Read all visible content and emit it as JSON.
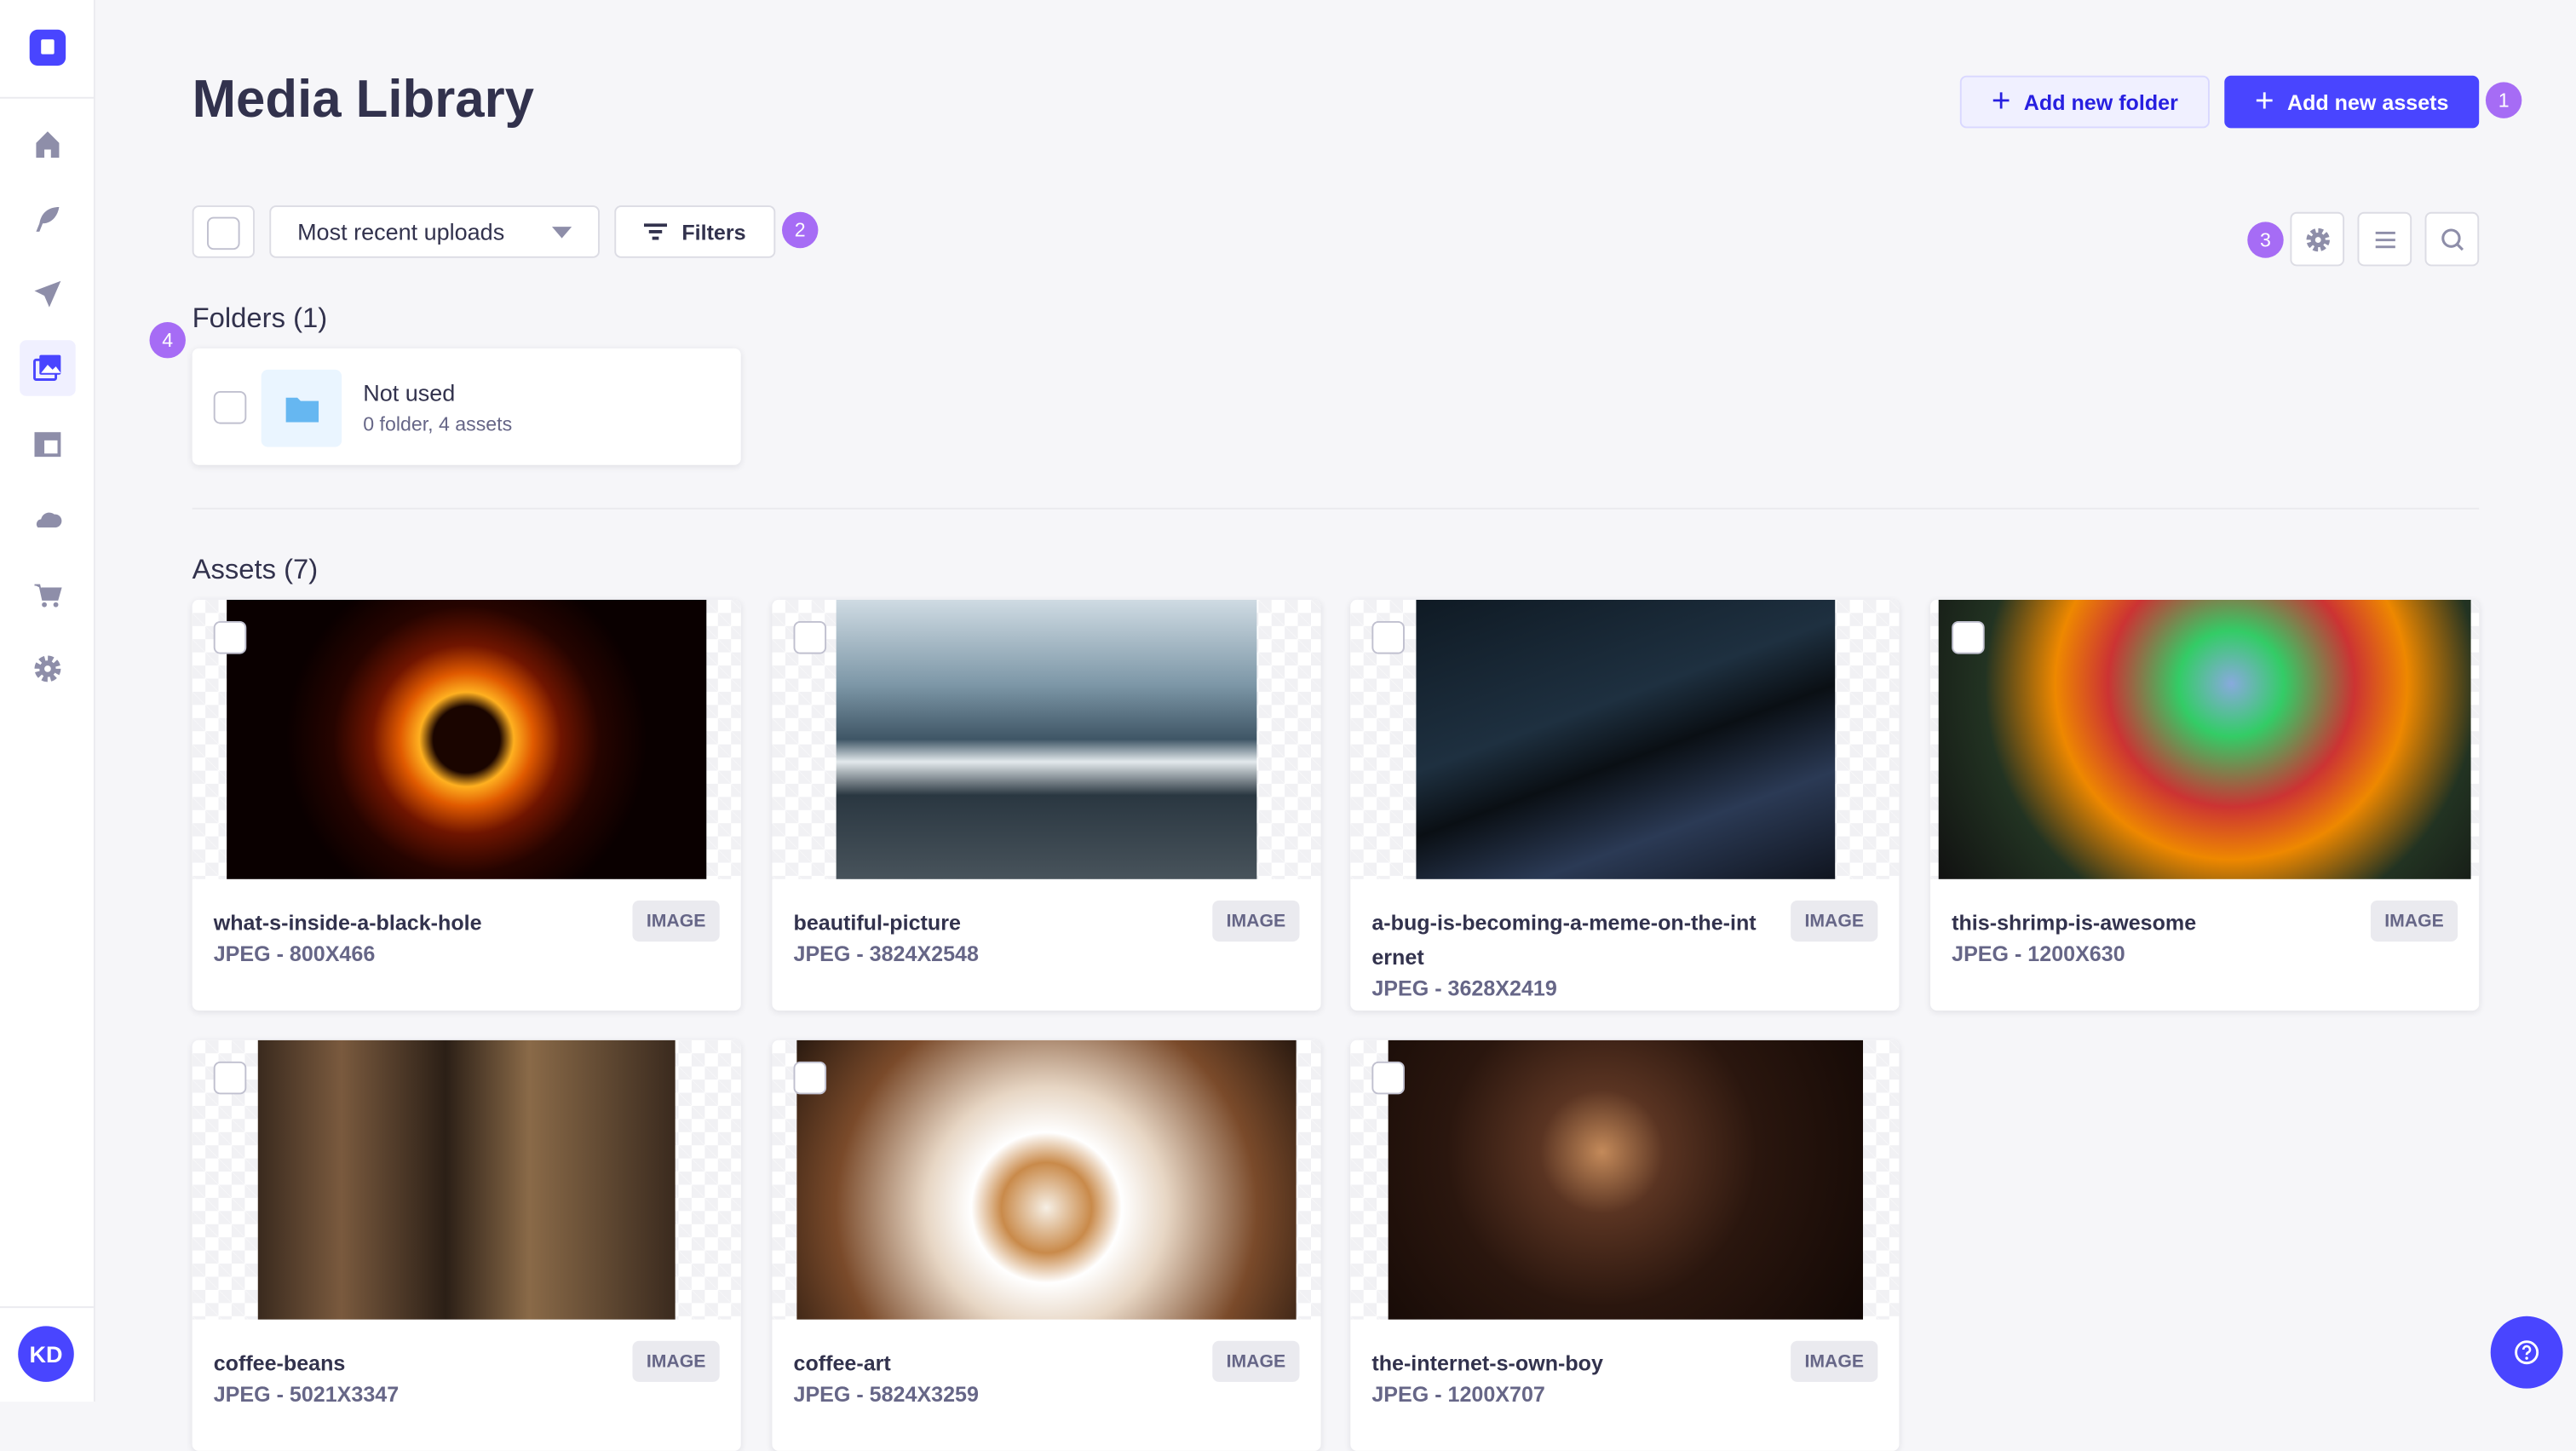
{
  "sidebar": {
    "items": [
      {
        "icon": "home-icon",
        "label": "Home"
      },
      {
        "icon": "feather-icon",
        "label": "Content Manager"
      },
      {
        "icon": "paper-plane-icon",
        "label": "Deploy"
      },
      {
        "icon": "images-icon",
        "label": "Media Library",
        "active": true
      },
      {
        "icon": "layout-icon",
        "label": "Content-Type Builder"
      },
      {
        "icon": "cloud-icon",
        "label": "Cloud"
      },
      {
        "icon": "cart-icon",
        "label": "Marketplace"
      },
      {
        "icon": "gear-icon",
        "label": "Settings"
      }
    ],
    "avatar": "KD"
  },
  "header": {
    "title": "Media Library",
    "add_folder": "Add new folder",
    "add_assets": "Add new assets"
  },
  "toolbar": {
    "sort_selected": "Most recent uploads",
    "filters": "Filters"
  },
  "badges": [
    "1",
    "2",
    "3",
    "4"
  ],
  "folders": {
    "heading": "Folders (1)",
    "items": [
      {
        "name": "Not used",
        "meta": "0 folder, 4 assets"
      }
    ]
  },
  "assets": {
    "heading": "Assets (7)",
    "items": [
      {
        "name": "what-s-inside-a-black-hole",
        "meta": "JPEG - 800X466",
        "type": "IMAGE"
      },
      {
        "name": "beautiful-picture",
        "meta": "JPEG - 3824X2548",
        "type": "IMAGE"
      },
      {
        "name": "a-bug-is-becoming-a-meme-on-the-internet",
        "meta": "JPEG - 3628X2419",
        "type": "IMAGE"
      },
      {
        "name": "this-shrimp-is-awesome",
        "meta": "JPEG - 1200X630",
        "type": "IMAGE"
      },
      {
        "name": "coffee-beans",
        "meta": "JPEG - 5021X3347",
        "type": "IMAGE"
      },
      {
        "name": "coffee-art",
        "meta": "JPEG - 5824X3259",
        "type": "IMAGE"
      },
      {
        "name": "the-internet-s-own-boy",
        "meta": "JPEG - 1200X707",
        "type": "IMAGE"
      }
    ]
  },
  "colors": {
    "primary": "#4945ff",
    "badge": "#a66cf5",
    "text": "#32324d",
    "muted": "#666687",
    "background": "#f6f6f9"
  }
}
